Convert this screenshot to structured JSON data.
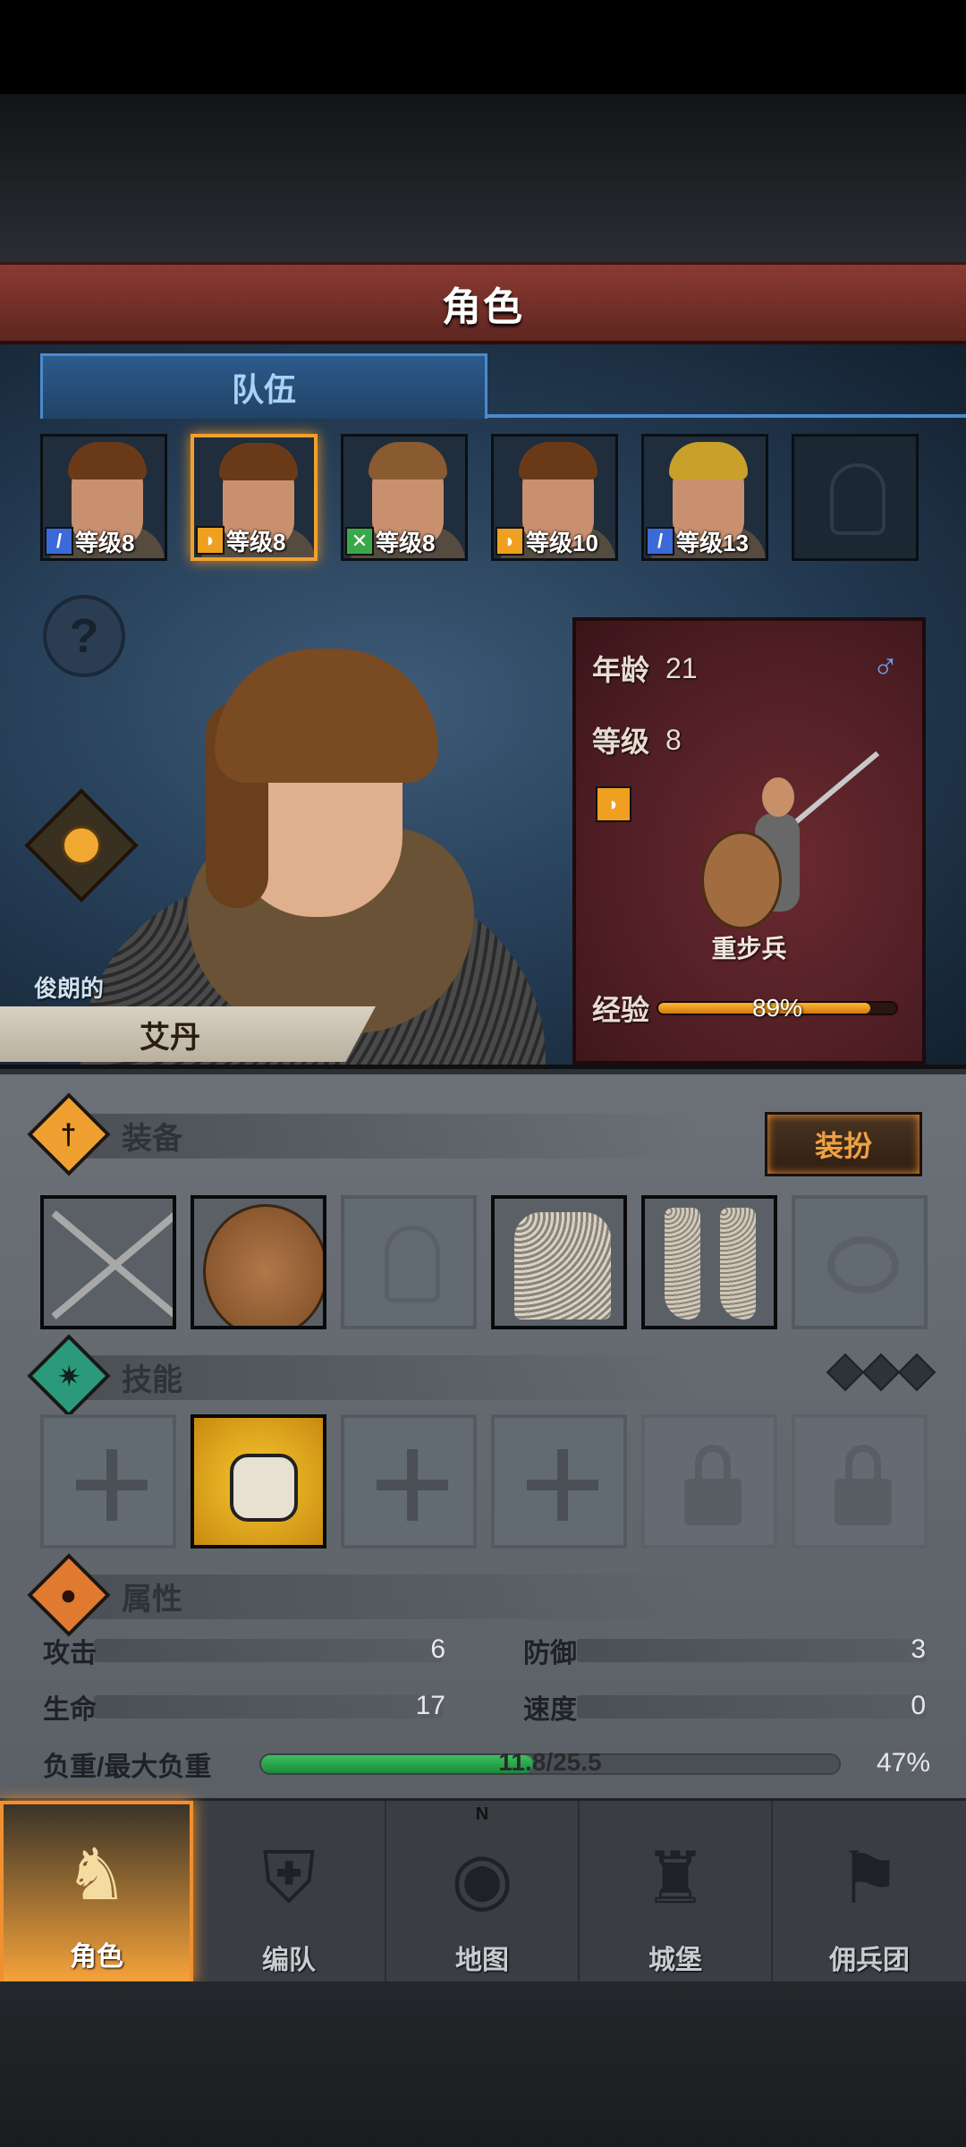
{
  "header": {
    "title": "角色"
  },
  "tabs": [
    {
      "label": "队伍",
      "active": true
    }
  ],
  "roster": [
    {
      "class": "sword",
      "level_label": "等级8",
      "selected": false,
      "hair": "brown"
    },
    {
      "class": "shield",
      "level_label": "等级8",
      "selected": true,
      "hair": "brown"
    },
    {
      "class": "bow",
      "level_label": "等级8",
      "selected": false,
      "hair": "brown2"
    },
    {
      "class": "shield",
      "level_label": "等级10",
      "selected": false,
      "hair": "brown"
    },
    {
      "class": "sword",
      "level_label": "等级13",
      "selected": false,
      "hair": "blond"
    },
    {
      "class": "empty",
      "level_label": "",
      "selected": false
    }
  ],
  "character": {
    "trait": "俊朗的",
    "name": "艾丹",
    "age_label": "年龄",
    "age": "21",
    "level_label": "等级",
    "level": "8",
    "gender_icon": "♂",
    "unit_type": "重步兵",
    "xp_label": "经验",
    "xp_percent": "89%",
    "xp_fraction": 0.89
  },
  "equipment": {
    "title": "装备",
    "dress_button": "装扮",
    "slots": [
      "weapon-swords",
      "shield",
      "helmet-empty",
      "chainmail",
      "boots",
      "ring-empty"
    ]
  },
  "skills": {
    "title": "技能",
    "slots": [
      "empty",
      "gauntlet-skill",
      "empty",
      "empty",
      "locked",
      "locked"
    ]
  },
  "attributes": {
    "title": "属性",
    "attack_label": "攻击",
    "attack": "6",
    "defense_label": "防御",
    "defense": "3",
    "life_label": "生命",
    "life": "17",
    "speed_label": "速度",
    "speed": "0",
    "load_label": "负重/最大负重",
    "load_text": "11.8/25.5",
    "load_percent": "47%",
    "load_fraction": 0.47
  },
  "nav": [
    {
      "label": "角色",
      "active": true
    },
    {
      "label": "编队",
      "active": false
    },
    {
      "label": "地图",
      "active": false
    },
    {
      "label": "城堡",
      "active": false
    },
    {
      "label": "佣兵团",
      "active": false
    }
  ],
  "compass_n": "N",
  "colors": {
    "accent": "#f09030",
    "header": "#7a322a",
    "tab": "#2c5b8c",
    "xp": "#f0a020",
    "load": "#2fae4e"
  }
}
